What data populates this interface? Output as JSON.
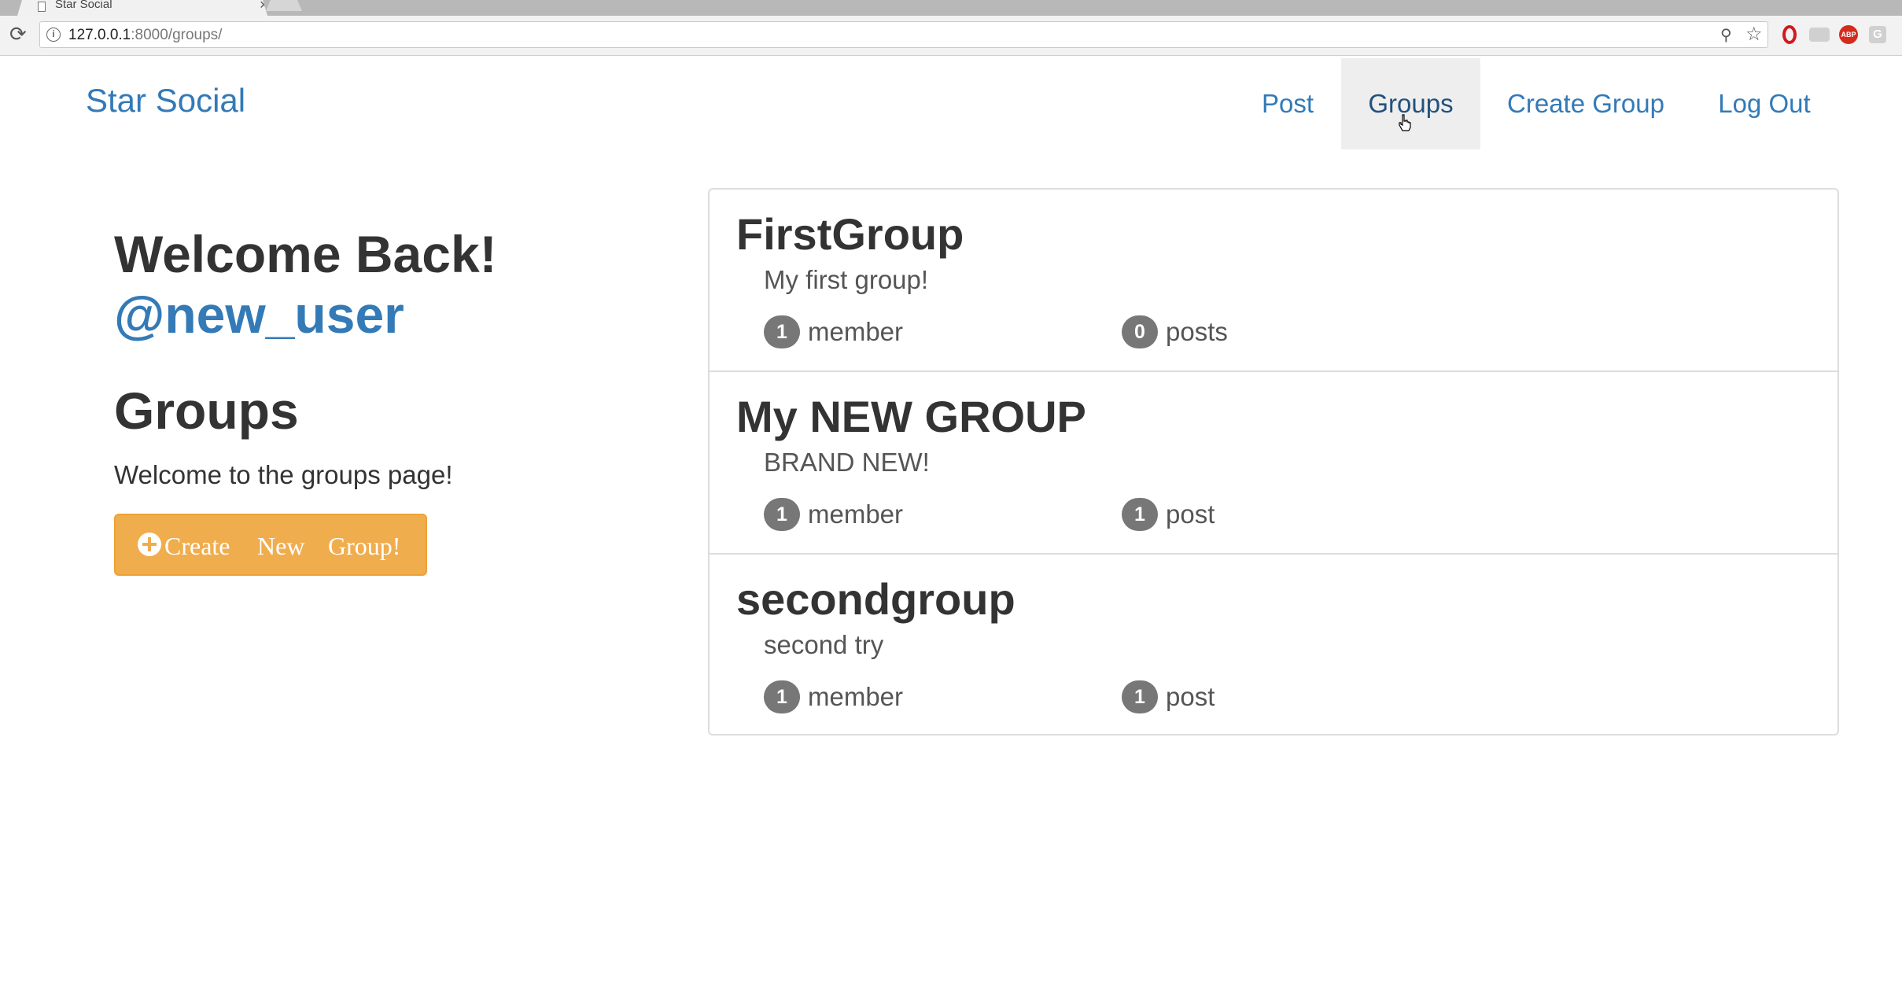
{
  "browser": {
    "tab_title": "Star Social",
    "tab_close_glyph": "×",
    "url_host": "127.0.0.1",
    "url_path": ":8000/groups/",
    "extension_abp_label": "ABP",
    "extension_g_label": "G"
  },
  "navbar": {
    "brand": "Star Social",
    "links": [
      "Post",
      "Groups",
      "Create Group",
      "Log Out"
    ],
    "active": "Groups"
  },
  "sidebar": {
    "welcome": "Welcome Back!",
    "username": "@new_user",
    "heading": "Groups",
    "intro": "Welcome to the groups page!",
    "create_button_words": [
      "Create",
      "New",
      "Group!"
    ],
    "create_button_color": "#f0ad4e"
  },
  "groups": [
    {
      "name": "FirstGroup",
      "description": "My first group!",
      "member_count": "1",
      "member_label": "member",
      "post_count": "0",
      "post_label": "posts"
    },
    {
      "name": "My NEW GROUP",
      "description": "BRAND NEW!",
      "member_count": "1",
      "member_label": "member",
      "post_count": "1",
      "post_label": "post"
    },
    {
      "name": "secondgroup",
      "description": "second try",
      "member_count": "1",
      "member_label": "member",
      "post_count": "1",
      "post_label": "post"
    }
  ],
  "colors": {
    "link": "#337ab7",
    "active_nav_bg": "#eeeeee",
    "badge": "#777777"
  }
}
